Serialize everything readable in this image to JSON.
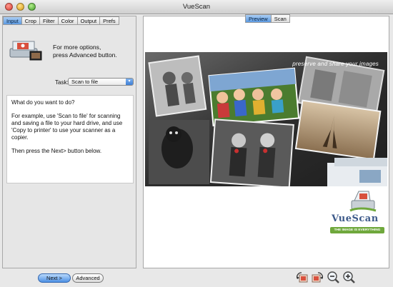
{
  "window": {
    "title": "VueScan"
  },
  "left_tabs": [
    {
      "label": "Input",
      "active": true
    },
    {
      "label": "Crop",
      "active": false
    },
    {
      "label": "Filter",
      "active": false
    },
    {
      "label": "Color",
      "active": false
    },
    {
      "label": "Output",
      "active": false
    },
    {
      "label": "Prefs",
      "active": false
    }
  ],
  "right_tabs": [
    {
      "label": "Preview",
      "active": true
    },
    {
      "label": "Scan",
      "active": false
    }
  ],
  "hint": {
    "line1": "For more options,",
    "line2": "press Advanced button."
  },
  "task": {
    "label": "Task:",
    "value": "Scan to file"
  },
  "help": {
    "p1": "What do you want to do?",
    "p2": "For example, use 'Scan to file' for scanning and saving a file to your hard drive, and use 'Copy to printer' to use your scanner as a copier.",
    "p3": "Then press the Next> button below."
  },
  "preview": {
    "caption": "preserve and share your images"
  },
  "logo": {
    "word": "VueScan",
    "tagline": "THE IMAGE IS EVERYTHING"
  },
  "buttons": {
    "next": "Next >",
    "advanced": "Advanced"
  },
  "icons": [
    "rotate-left-icon",
    "rotate-right-icon",
    "zoom-out-icon",
    "zoom-in-icon",
    "scanner-icon"
  ],
  "colors": {
    "accent": "#5c9ae2",
    "logo_blue": "#3d5a8a",
    "logo_green": "#6fa83c"
  }
}
